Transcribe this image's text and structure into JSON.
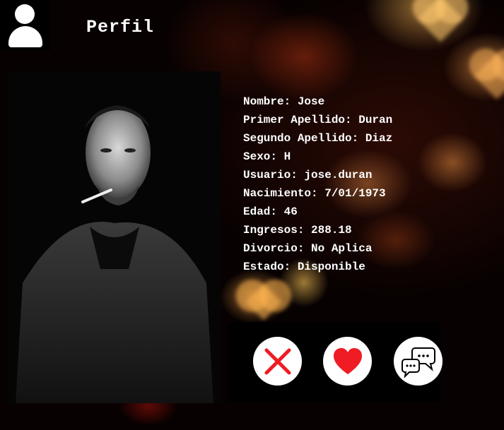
{
  "header": {
    "title": "Perfil",
    "avatar_icon": "user-icon"
  },
  "profile": {
    "photo_alt": "profile-photo",
    "fields": [
      {
        "label": "Nombre",
        "value": "Jose",
        "text": "Nombre: Jose"
      },
      {
        "label": "Primer Apellido",
        "value": "Duran",
        "text": "Primer Apellido: Duran"
      },
      {
        "label": "Segundo Apellido",
        "value": "Diaz",
        "text": "Segundo Apellido: Diaz"
      },
      {
        "label": "Sexo",
        "value": "H",
        "text": "Sexo: H"
      },
      {
        "label": "Usuario",
        "value": "jose.duran",
        "text": "Usuario: jose.duran"
      },
      {
        "label": "Nacimiento",
        "value": "7/01/1973",
        "text": "Nacimiento: 7/01/1973"
      },
      {
        "label": "Edad",
        "value": "46",
        "text": "Edad: 46"
      },
      {
        "label": "Ingresos",
        "value": "288.18",
        "text": "Ingresos: 288.18"
      },
      {
        "label": "Divorcio",
        "value": "No Aplica",
        "text": "Divorcio: No Aplica"
      },
      {
        "label": "Estado",
        "value": "Disponible",
        "text": "Estado: Disponible"
      }
    ]
  },
  "actions": {
    "reject_icon": "close-icon",
    "like_icon": "heart-icon",
    "chat_icon": "chat-icon",
    "colors": {
      "reject": "#ef1c24",
      "like": "#ef1c24",
      "chat": "#000000"
    }
  }
}
